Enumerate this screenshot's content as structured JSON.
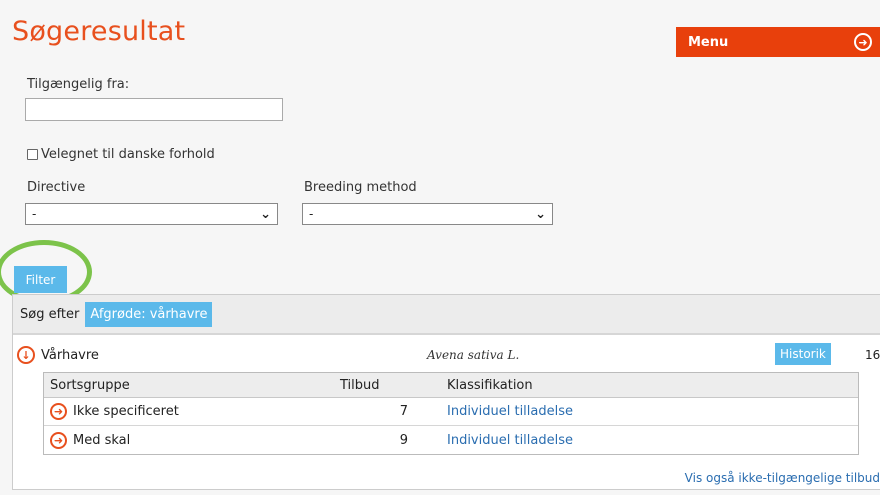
{
  "page": {
    "title": "Søgeresultat"
  },
  "menu": {
    "label": "Menu",
    "icon": "circle-arrow-right-icon"
  },
  "filters": {
    "available_from_label": "Tilgængelig fra:",
    "available_from_value": "",
    "danish_conditions_label": "Velegnet til danske forhold",
    "danish_conditions_checked": false,
    "directive_label": "Directive",
    "directive_value": "-",
    "breeding_method_label": "Breeding method",
    "breeding_method_value": "-",
    "filter_button": "Filter"
  },
  "search": {
    "label": "Søg efter",
    "tag": "Afgrøde: vårhavre"
  },
  "crop": {
    "name": "Vårhavre",
    "latin": "Avena sativa L.",
    "history_button": "Historik",
    "count": "16"
  },
  "subtable": {
    "headers": {
      "group": "Sortsgruppe",
      "offers": "Tilbud",
      "classification": "Klassifikation"
    },
    "rows": [
      {
        "group": "Ikke specificeret",
        "offers": "7",
        "classification": "Individuel tilladelse"
      },
      {
        "group": "Med skal",
        "offers": "9",
        "classification": "Individuel tilladelse"
      }
    ]
  },
  "footer": {
    "show_unavailable": "Vis også ikke-tilgængelige tilbud"
  },
  "colors": {
    "accent": "#e8501e",
    "menu": "#e8400c",
    "button": "#5bb9ea",
    "highlight": "#7cc34a",
    "link": "#2a6db0"
  }
}
